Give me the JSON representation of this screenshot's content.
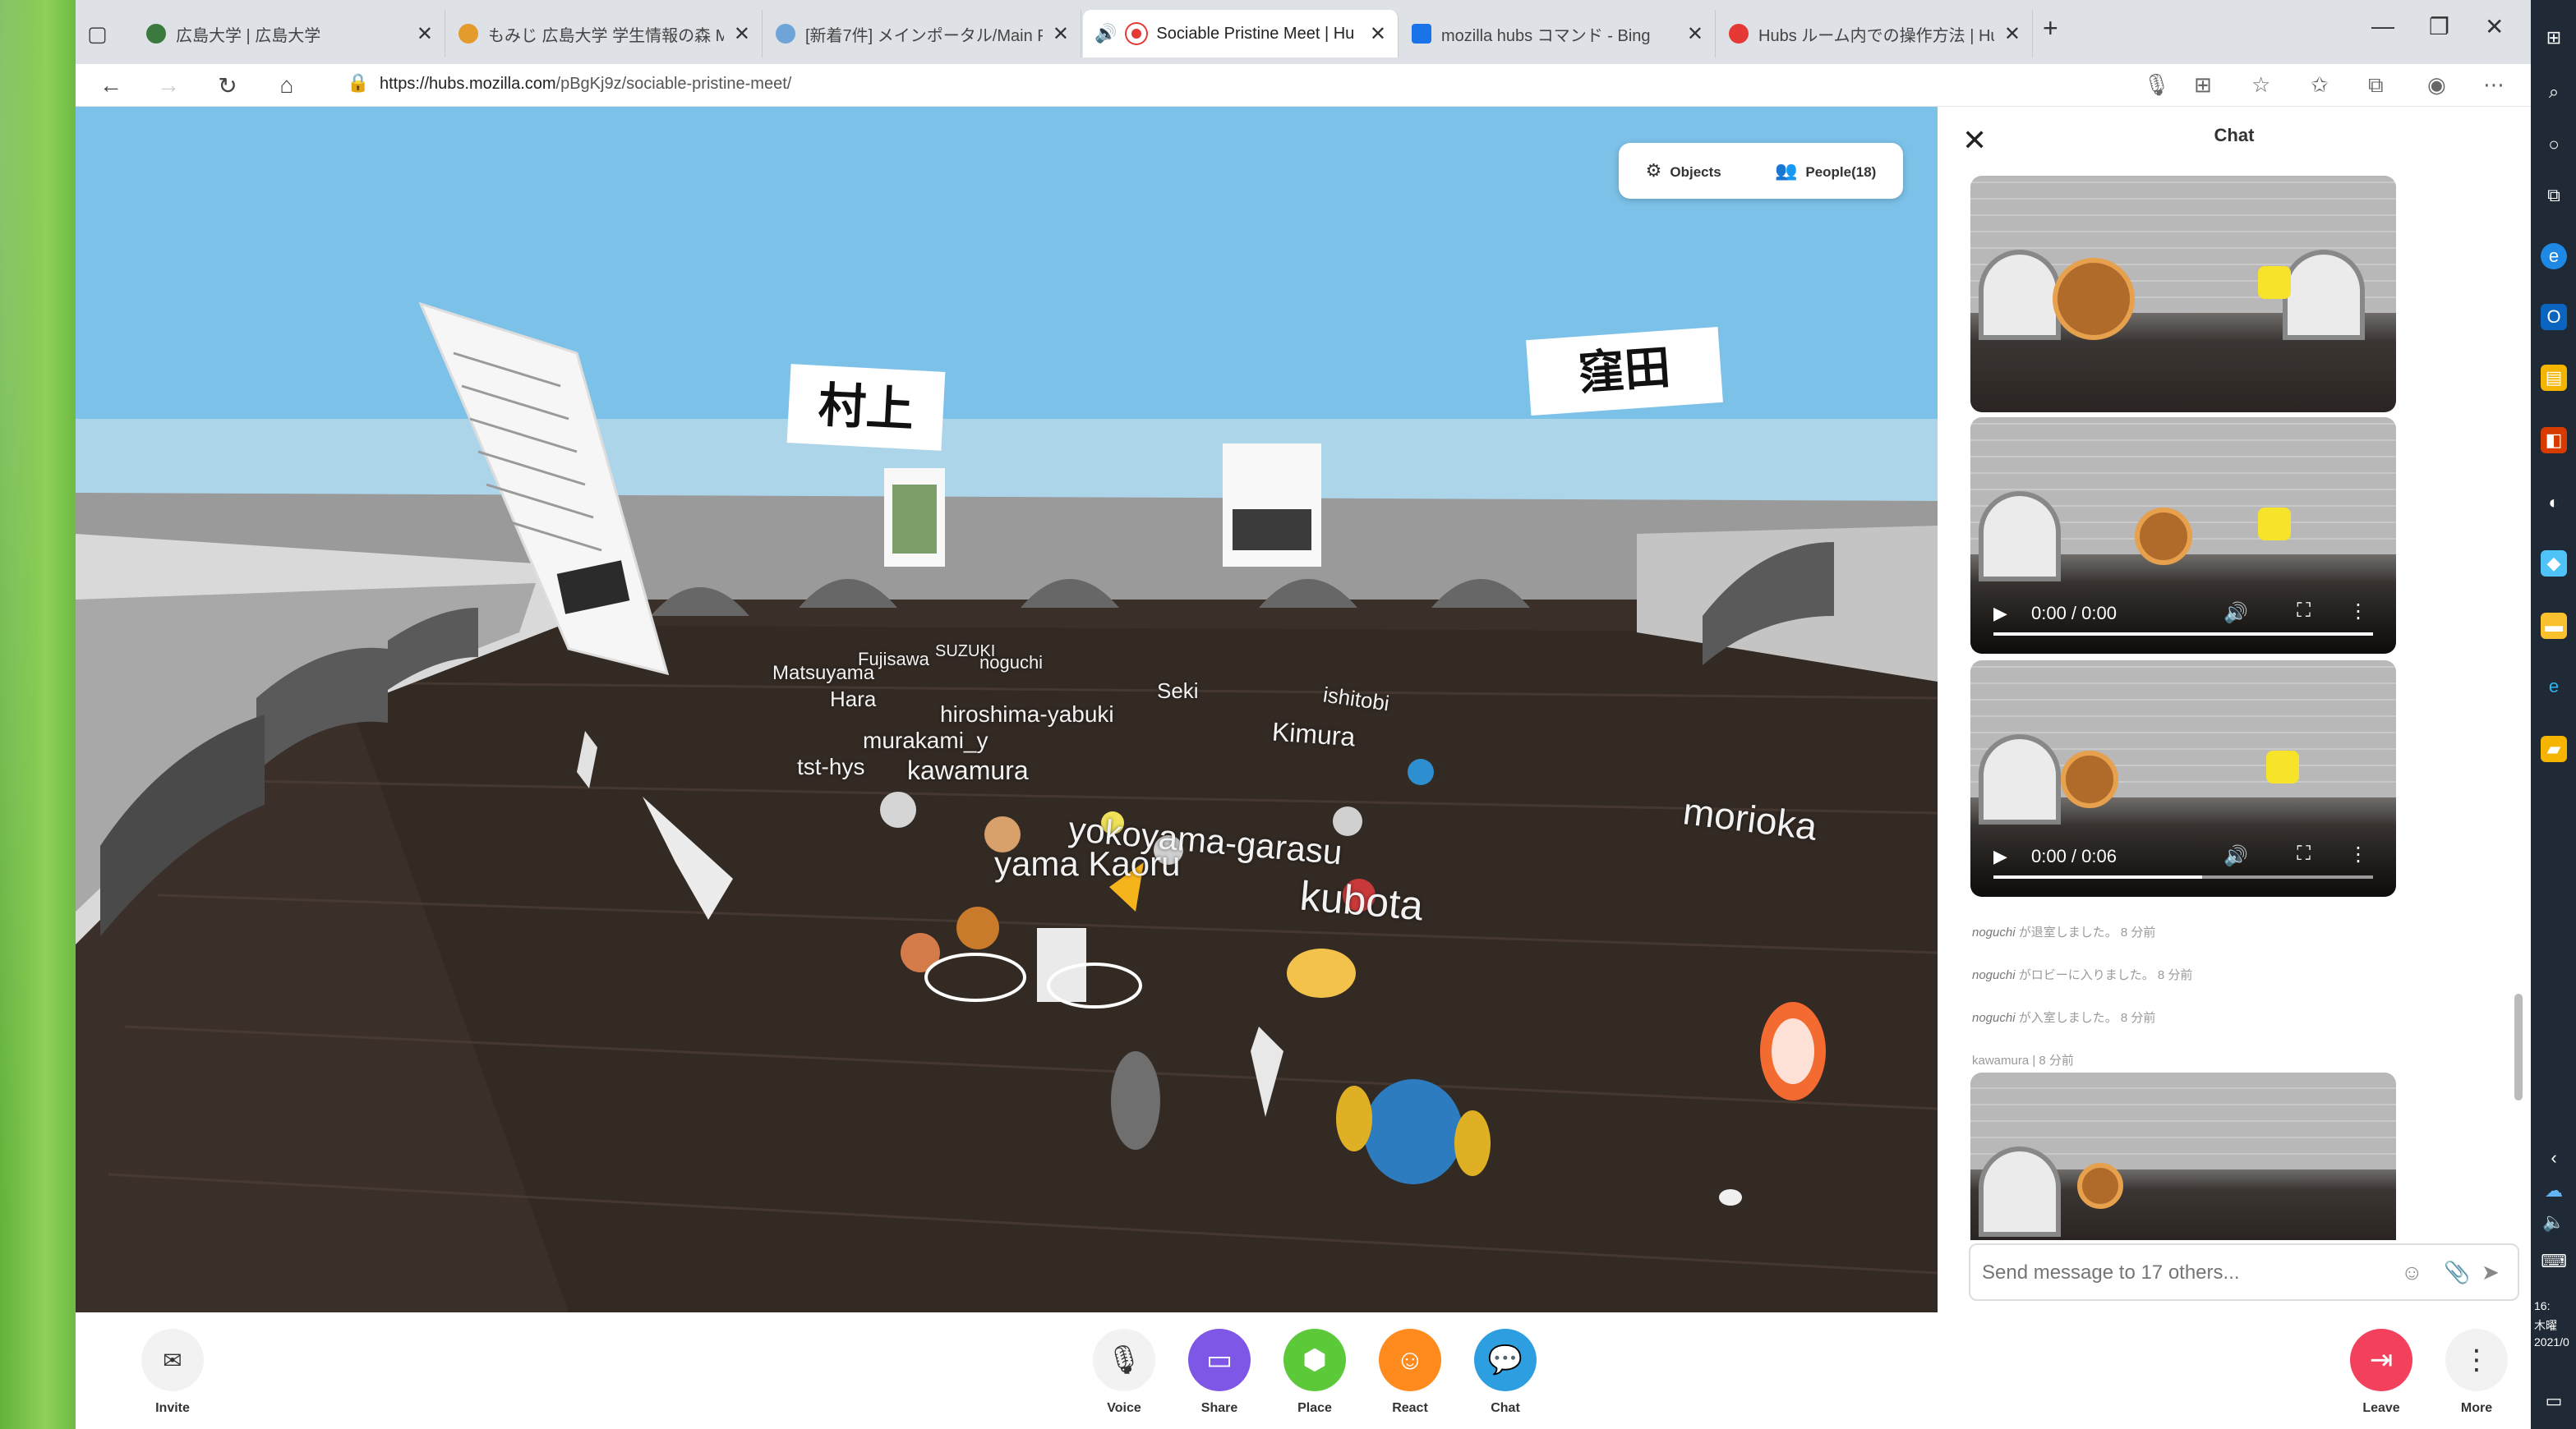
{
  "browser": {
    "tabs": [
      {
        "title": "広島大学 | 広島大学",
        "favicon_color": "#3b7a3f"
      },
      {
        "title": "もみじ 広島大学 学生情報の森 M",
        "favicon_color": "#e39b2c"
      },
      {
        "title": "[新着7件] メインポータル/Main Por",
        "favicon_color": "#6fa4d9"
      },
      {
        "title": "Sociable Pristine Meet | Hu",
        "favicon_color": "#e53935"
      },
      {
        "title": "mozilla hubs コマンド - Bing",
        "favicon_color": "#1a73e8"
      },
      {
        "title": "Hubs ルーム内での操作方法 | Hub",
        "favicon_color": "#e53935"
      }
    ],
    "new_tab": "+",
    "url_host": "https://hubs.mozilla.com",
    "url_path": "/pBgKj9z/sociable-pristine-meet/"
  },
  "scene": {
    "objects_label": "Objects",
    "people_label": "People(18)",
    "signs": [
      "村上",
      "窪田"
    ],
    "nametags": [
      "Matsuyama",
      "Fujisawa",
      "SUZUKI",
      "noguchi",
      "Hara",
      "hiroshima-yabuki",
      "murakami_y",
      "tst-hys",
      "kawamura",
      "Seki",
      "ishitobi",
      "Kimura",
      "yokoyama-garasu",
      "yama Kaoru",
      "kubota",
      "morioka"
    ]
  },
  "chat": {
    "title": "Chat",
    "videos": [
      {
        "time": "0:00 / 0:00",
        "progress": 1.0
      },
      {
        "time": "0:00 / 0:06",
        "progress": 0.55
      }
    ],
    "system_messages": [
      {
        "user": "noguchi",
        "text": "が退室しました。 8 分前"
      },
      {
        "user": "noguchi",
        "text": "がロビーに入りました。 8 分前"
      },
      {
        "user": "noguchi",
        "text": "が入室しました。 8 分前"
      }
    ],
    "last_sender": "kawamura | 8 分前",
    "input_placeholder": "Send message to 17 others..."
  },
  "toolbar": {
    "invite": "Invite",
    "voice": "Voice",
    "share": "Share",
    "place": "Place",
    "react": "React",
    "chat": "Chat",
    "leave": "Leave",
    "more": "More"
  },
  "taskbar": {
    "time": "16:",
    "day": "木曜",
    "date": "2021/0"
  },
  "colors": {
    "share": "#7e57e6",
    "place": "#5cc93a",
    "react": "#ff8a1d",
    "chat": "#2d9ee0",
    "leave": "#f2405d"
  }
}
